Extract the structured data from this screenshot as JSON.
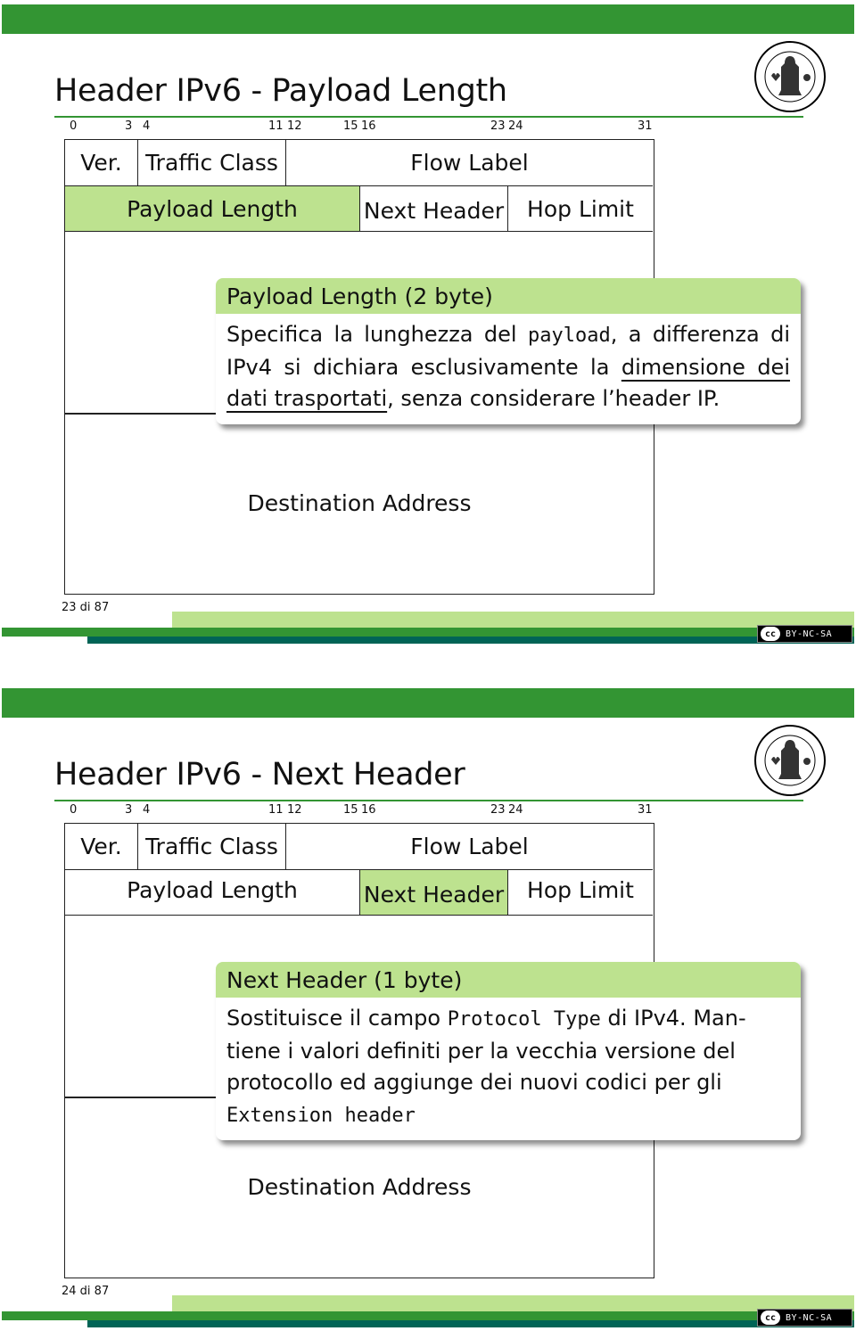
{
  "colors": {
    "brand_green": "#339533",
    "highlight_green": "#bde28f",
    "teal": "#006456"
  },
  "bit_numbers": [
    "0",
    "3",
    "4",
    "11",
    "12",
    "15",
    "16",
    "23",
    "24",
    "31"
  ],
  "header_fields": {
    "version": "Ver.",
    "traffic_class": "Traffic Class",
    "flow_label": "Flow Label",
    "payload_length": "Payload Length",
    "next_header": "Next Header",
    "hop_limit": "Hop Limit",
    "destination_address": "Destination Address"
  },
  "license": {
    "cc_label": "cc",
    "text": "BY-NC-SA"
  },
  "slides": [
    {
      "title": "Header IPv6 - Payload Length",
      "highlighted_field": "payload_length",
      "callout": {
        "heading": "Payload Length (2 byte)",
        "body_parts": [
          "Specifica la lunghezza del ",
          "payload",
          ", a dif­ferenza di IPv4 si dichiara esclusivamente la ",
          "dimensione dei dati trasportati",
          ", senza considerare l’header IP."
        ]
      },
      "page_indicator": "23 di 87"
    },
    {
      "title": "Header IPv6 - Next Header",
      "highlighted_field": "next_header",
      "callout": {
        "heading": "Next Header (1 byte)",
        "body_parts": [
          "Sostituisce il campo ",
          "Protocol Type",
          " di IPv4. Man­tiene i valori definiti per la vecchia versione del proto­collo ed aggiunge dei nuovi codici per gli ",
          "Extension header"
        ]
      },
      "page_indicator": "24 di 87"
    }
  ]
}
